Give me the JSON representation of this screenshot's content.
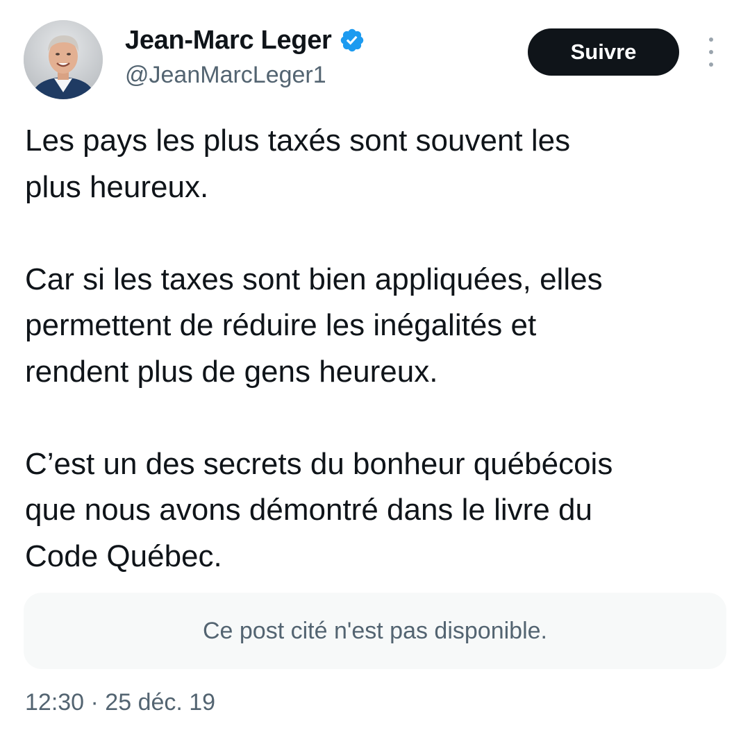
{
  "author": {
    "display_name": "Jean-Marc Leger",
    "handle": "@JeanMarcLeger1",
    "verified": true,
    "verified_color": "#1d9bf0"
  },
  "actions": {
    "follow_label": "Suivre",
    "more_icon": "more-vertical-icon"
  },
  "post": {
    "paragraphs": [
      "Les pays les plus taxés sont souvent les\nplus heureux.",
      "Car si les taxes sont bien appliquées, elles\npermettent de réduire les inégalités et\nrendent plus de gens heureux.",
      "C’est un des secrets du bonheur québécois\nque nous avons démontré dans le livre du\nCode Québec."
    ],
    "quoted_post_notice": "Ce post cité n'est pas disponible.",
    "timestamp": "12:30 · 25 déc. 19"
  }
}
